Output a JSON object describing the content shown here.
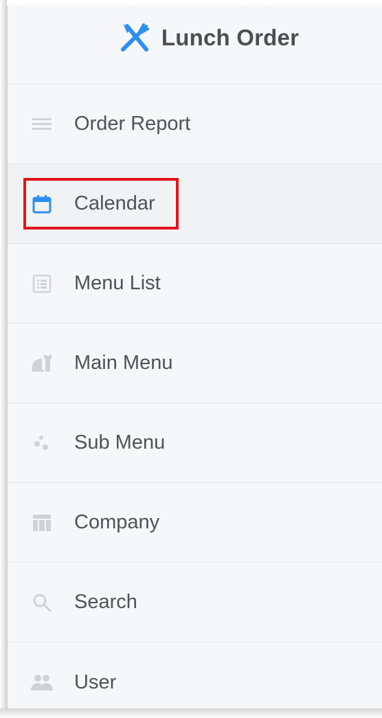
{
  "brand": {
    "title": "Lunch Order",
    "icon": "utensils-crossed-icon",
    "accent": "#2b8ff0"
  },
  "nav": {
    "items": [
      {
        "label": "Order Report",
        "icon": "lines-icon"
      },
      {
        "label": "Calendar",
        "icon": "calendar-icon",
        "highlighted": true,
        "icon_color": "#2b8ff0"
      },
      {
        "label": "Menu List",
        "icon": "list-icon"
      },
      {
        "label": "Main Menu",
        "icon": "food-tray-icon"
      },
      {
        "label": "Sub Menu",
        "icon": "dots-icon"
      },
      {
        "label": "Company",
        "icon": "building-icon"
      },
      {
        "label": "Search",
        "icon": "search-icon"
      },
      {
        "label": "User",
        "icon": "users-icon"
      }
    ]
  },
  "colors": {
    "text": "#4e5358",
    "icon_muted": "#cfd3d8",
    "highlight": "#e3131b"
  }
}
